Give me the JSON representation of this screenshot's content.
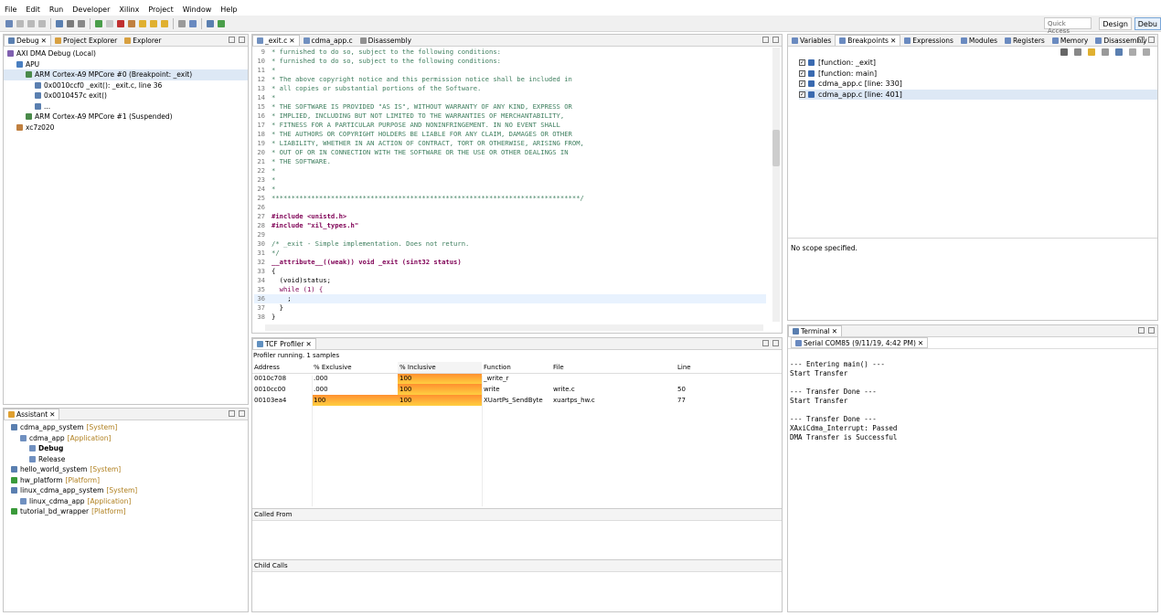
{
  "menu": [
    "File",
    "Edit",
    "Run",
    "Developer",
    "Xilinx",
    "Project",
    "Window",
    "Help"
  ],
  "toolbar": {
    "quick_access": "Quick Access",
    "perspective_design": "Design",
    "perspective_debug": "Debu"
  },
  "debug_panel": {
    "tabs": [
      "Debug",
      "Project Explorer",
      "Explorer"
    ],
    "tree": [
      {
        "label": "AXI DMA Debug (Local)",
        "indent": 0
      },
      {
        "label": "APU",
        "indent": 1
      },
      {
        "label": "ARM Cortex-A9 MPCore #0 (Breakpoint: _exit)",
        "indent": 2
      },
      {
        "label": "0x0010ccf0 _exit(): _exit.c, line 36",
        "indent": 3
      },
      {
        "label": "0x0010457c exit()",
        "indent": 3
      },
      {
        "label": "...",
        "indent": 3
      },
      {
        "label": "ARM Cortex-A9 MPCore #1 (Suspended)",
        "indent": 2
      },
      {
        "label": "xc7z020",
        "indent": 1
      }
    ]
  },
  "assistant_panel": {
    "tab": "Assistant",
    "tree": [
      {
        "label": "cdma_app_system",
        "tag": "[System]",
        "indent": 0
      },
      {
        "label": "cdma_app",
        "tag": "[Application]",
        "indent": 1
      },
      {
        "label": "Debug",
        "tag": "",
        "indent": 2,
        "bold": true
      },
      {
        "label": "Release",
        "tag": "",
        "indent": 2
      },
      {
        "label": "hello_world_system",
        "tag": "[System]",
        "indent": 0
      },
      {
        "label": "hw_platform",
        "tag": "[Platform]",
        "indent": 0
      },
      {
        "label": "linux_cdma_app_system",
        "tag": "[System]",
        "indent": 0
      },
      {
        "label": "linux_cdma_app",
        "tag": "[Application]",
        "indent": 1
      },
      {
        "label": "tutorial_bd_wrapper",
        "tag": "[Platform]",
        "indent": 0
      }
    ]
  },
  "editor": {
    "tabs": [
      "_exit.c",
      "cdma_app.c",
      "Disassembly"
    ],
    "lines": [
      {
        "n": "9",
        "t": "* furnished to do so, subject to the following conditions:",
        "c": "cm"
      },
      {
        "n": "10",
        "t": "* furnished to do so, subject to the following conditions:",
        "c": "cm"
      },
      {
        "n": "11",
        "t": "*",
        "c": "cm"
      },
      {
        "n": "12",
        "t": "* The above copyright notice and this permission notice shall be included in",
        "c": "cm"
      },
      {
        "n": "13",
        "t": "* all copies or substantial portions of the Software.",
        "c": "cm"
      },
      {
        "n": "14",
        "t": "*",
        "c": "cm"
      },
      {
        "n": "15",
        "t": "* THE SOFTWARE IS PROVIDED \"AS IS\", WITHOUT WARRANTY OF ANY KIND, EXPRESS OR",
        "c": "cm"
      },
      {
        "n": "16",
        "t": "* IMPLIED, INCLUDING BUT NOT LIMITED TO THE WARRANTIES OF MERCHANTABILITY,",
        "c": "cm"
      },
      {
        "n": "17",
        "t": "* FITNESS FOR A PARTICULAR PURPOSE AND NONINFRINGEMENT. IN NO EVENT SHALL",
        "c": "cm"
      },
      {
        "n": "18",
        "t": "* THE AUTHORS OR COPYRIGHT HOLDERS BE LIABLE FOR ANY CLAIM, DAMAGES OR OTHER",
        "c": "cm"
      },
      {
        "n": "19",
        "t": "* LIABILITY, WHETHER IN AN ACTION OF CONTRACT, TORT OR OTHERWISE, ARISING FROM,",
        "c": "cm"
      },
      {
        "n": "20",
        "t": "* OUT OF OR IN CONNECTION WITH THE SOFTWARE OR THE USE OR OTHER DEALINGS IN",
        "c": "cm"
      },
      {
        "n": "21",
        "t": "* THE SOFTWARE.",
        "c": "cm"
      },
      {
        "n": "22",
        "t": "*",
        "c": "cm"
      },
      {
        "n": "23",
        "t": "*",
        "c": "cm"
      },
      {
        "n": "24",
        "t": "*",
        "c": "cm"
      },
      {
        "n": "25",
        "t": "******************************************************************************/",
        "c": "cm"
      },
      {
        "n": "26",
        "t": "",
        "c": ""
      },
      {
        "n": "27",
        "t": "#include <unistd.h>",
        "c": "inc1"
      },
      {
        "n": "28",
        "t": "#include \"xil_types.h\"",
        "c": "inc2"
      },
      {
        "n": "29",
        "t": "",
        "c": ""
      },
      {
        "n": "30",
        "t": "/* _exit - Simple implementation. Does not return.",
        "c": "cm"
      },
      {
        "n": "31",
        "t": "*/",
        "c": "cm"
      },
      {
        "n": "32",
        "t": "__attribute__((weak)) void _exit (sint32 status)",
        "c": "fn"
      },
      {
        "n": "33",
        "t": "{",
        "c": ""
      },
      {
        "n": "34",
        "t": "  (void)status;",
        "c": ""
      },
      {
        "n": "35",
        "t": "  while (1) {",
        "c": "wh"
      },
      {
        "n": "36",
        "t": "    ;",
        "c": "hl"
      },
      {
        "n": "37",
        "t": "  }",
        "c": ""
      },
      {
        "n": "38",
        "t": "}",
        "c": ""
      },
      {
        "n": "39",
        "t": "",
        "c": ""
      }
    ]
  },
  "profiler": {
    "tab": "TCF Profiler",
    "status": "Profiler running. 1 samples",
    "headers": [
      "Address",
      "% Exclusive",
      "% Inclusive",
      "Function",
      "File",
      "Line"
    ],
    "rows": [
      {
        "address": "0010c708",
        "exclusive": ".000",
        "inclusive": "100",
        "function": "_write_r",
        "file": "",
        "line": "",
        "exclusive_pct": 0,
        "inclusive_pct": 100
      },
      {
        "address": "0010cc00",
        "exclusive": ".000",
        "inclusive": "100",
        "function": "write",
        "file": "write.c",
        "line": "50",
        "exclusive_pct": 0,
        "inclusive_pct": 100
      },
      {
        "address": "00103ea4",
        "exclusive": "100",
        "inclusive": "100",
        "function": "XUartPs_SendByte",
        "file": "xuartps_hw.c",
        "line": "77",
        "exclusive_pct": 100,
        "inclusive_pct": 100
      }
    ],
    "called_from": "Called From",
    "child_calls": "Child Calls"
  },
  "breakpoints_panel": {
    "tabs": [
      "Variables",
      "Breakpoints",
      "Expressions",
      "Modules",
      "Registers",
      "Memory",
      "Disassembly"
    ],
    "items": [
      "[function: _exit]",
      "[function: main]",
      "cdma_app.c [line: 330]",
      "cdma_app.c [line: 401]"
    ],
    "no_scope": "No scope specified."
  },
  "terminal": {
    "tab": "Terminal",
    "session": "Serial COM85 (9/11/19, 4:42 PM)",
    "lines": [
      "",
      "--- Entering main() ---",
      "Start Transfer",
      "",
      "--- Transfer Done ---",
      "Start Transfer",
      "",
      "--- Transfer Done ---",
      "XAxiCdma_Interrupt: Passed",
      "DMA Transfer is Successful"
    ]
  },
  "colors": {
    "accent": "#3399ff",
    "bar_orange": "#ff9030",
    "bar_yellow": "#ffcf40",
    "highlight_line": "#e8f2fe",
    "comment": "#3f7f5f",
    "keyword": "#7f0055",
    "string": "#2a00ff"
  }
}
